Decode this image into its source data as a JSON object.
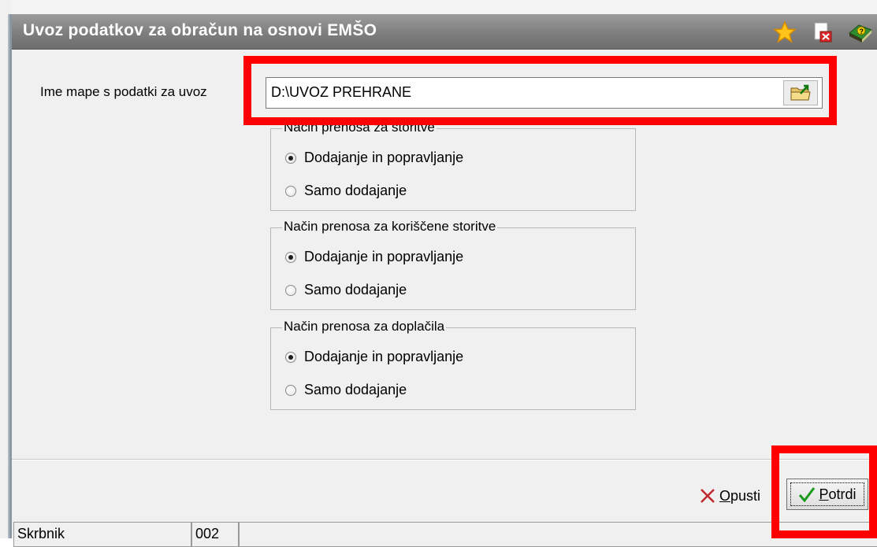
{
  "window": {
    "title": "Uvoz podatkov za obračun na osnovi EMŠO",
    "title_icons": [
      "star-icon",
      "close-document-icon",
      "help-book-icon"
    ]
  },
  "folder": {
    "label": "Ime mape s podatki za uvoz",
    "value": "D:\\UVOZ PREHRANE",
    "browse_icon": "folder-browse-icon"
  },
  "groups": [
    {
      "legend": "Način prenosa za storitve",
      "options": [
        {
          "label": "Dodajanje in popravljanje",
          "checked": true
        },
        {
          "label": "Samo dodajanje",
          "checked": false
        }
      ]
    },
    {
      "legend": "Način prenosa za koriščene storitve",
      "options": [
        {
          "label": "Dodajanje in popravljanje",
          "checked": true
        },
        {
          "label": "Samo dodajanje",
          "checked": false
        }
      ]
    },
    {
      "legend": "Način prenosa za doplačila",
      "options": [
        {
          "label": "Dodajanje in popravljanje",
          "checked": true
        },
        {
          "label": "Samo dodajanje",
          "checked": false
        }
      ]
    }
  ],
  "buttons": {
    "cancel": {
      "u": "O",
      "rest": "pusti"
    },
    "ok": {
      "u": "P",
      "rest": "otrdi"
    }
  },
  "status": {
    "user": "Skrbnik",
    "code": "002",
    "extra": ""
  },
  "colors": {
    "highlight": "#ff0000",
    "title_bar": "#7e7e7e",
    "check_green": "#1a9a1a",
    "cancel_x": "#c0282d"
  }
}
